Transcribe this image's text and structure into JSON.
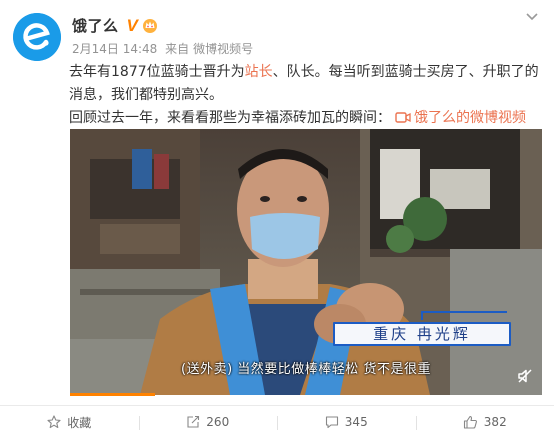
{
  "post": {
    "author": "饿了么",
    "verified_badge": "V",
    "timestamp": "2月14日 14:48",
    "source_prefix": "来自",
    "source": "微博视频号",
    "text_part1": "去年有1877位蓝骑士晋升为",
    "link_1": "站长",
    "text_part2": "、队长。每当听到蓝骑士买房了、升职了的消息，我们都特别高兴。",
    "text_line2": "回顾过去一年，来看看那些为幸福添砖加瓦的瞬间：",
    "video_link": "饿了么的微博视频"
  },
  "video": {
    "name_caption": "重庆 冉光辉",
    "subtitle": "(送外卖) 当然要比做棒棒轻松 货不是很重",
    "progress": 0.18
  },
  "actions": {
    "favorite": "收藏",
    "repost": "260",
    "comment": "345",
    "like": "382"
  },
  "colors": {
    "brand_blue": "#1a9be8",
    "link": "#eb7350",
    "vip": "#ff8200",
    "caption_blue": "#1c5cc4"
  }
}
